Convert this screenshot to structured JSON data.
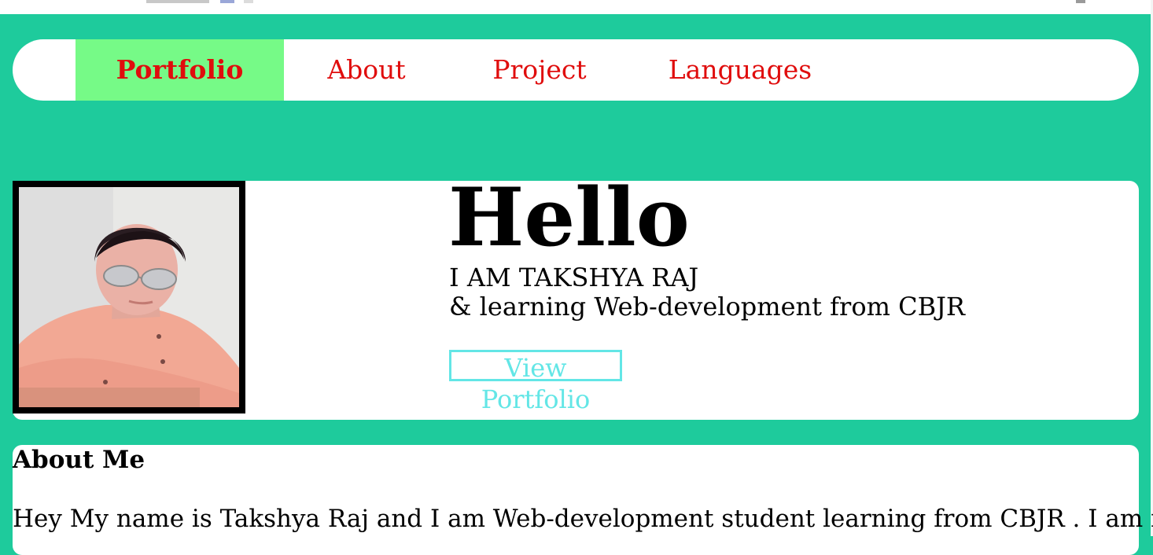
{
  "nav": {
    "items": [
      {
        "label": "Portfolio",
        "active": true
      },
      {
        "label": "About",
        "active": false
      },
      {
        "label": "Project",
        "active": false
      },
      {
        "label": "Languages",
        "active": false
      }
    ]
  },
  "hero": {
    "greeting": "Hello",
    "line1": "I AM TAKSHYA RAJ",
    "line2": "& learning Web-development from CBJR",
    "button_label": "View Portfolio"
  },
  "about": {
    "title": "About Me",
    "text": "Hey My name is Takshya Raj and I am Web-development student learning from CBJR . I am in"
  },
  "colors": {
    "page_bg": "#1ecb9c",
    "nav_active_bg": "#76fa87",
    "nav_text": "#e00d0d",
    "button_accent": "#63e6e6"
  }
}
